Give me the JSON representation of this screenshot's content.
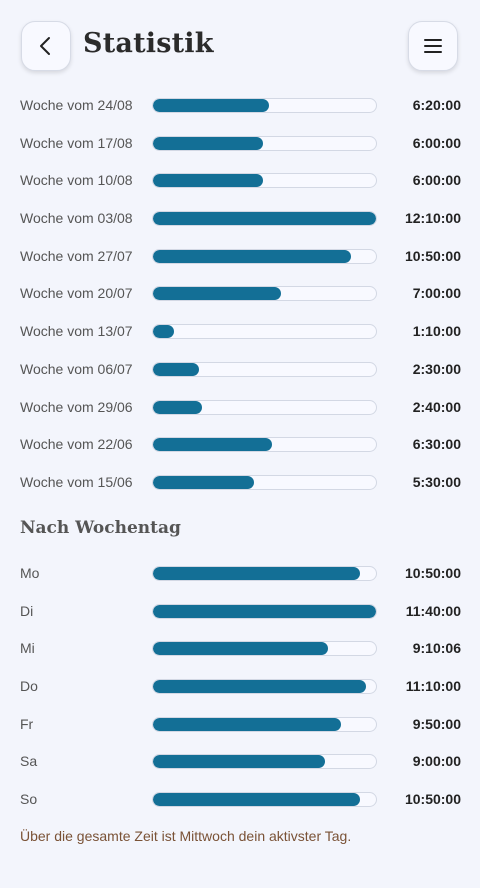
{
  "header": {
    "title": "Statistik",
    "back_icon": "chevron-left-icon",
    "menu_icon": "hamburger-menu-icon"
  },
  "weeks": [
    {
      "label": "Woche vom 24/08",
      "time": "6:20:00",
      "fraction": 0.519
    },
    {
      "label": "Woche vom 17/08",
      "time": "6:00:00",
      "fraction": 0.492
    },
    {
      "label": "Woche vom 10/08",
      "time": "6:00:00",
      "fraction": 0.492
    },
    {
      "label": "Woche vom 03/08",
      "time": "12:10:00",
      "fraction": 1.0
    },
    {
      "label": "Woche vom 27/07",
      "time": "10:50:00",
      "fraction": 0.89
    },
    {
      "label": "Woche vom 20/07",
      "time": "7:00:00",
      "fraction": 0.575
    },
    {
      "label": "Woche vom 13/07",
      "time": "1:10:00",
      "fraction": 0.096
    },
    {
      "label": "Woche vom 06/07",
      "time": "2:30:00",
      "fraction": 0.205
    },
    {
      "label": "Woche vom 29/06",
      "time": "2:40:00",
      "fraction": 0.219
    },
    {
      "label": "Woche vom 22/06",
      "time": "6:30:00",
      "fraction": 0.534
    },
    {
      "label": "Woche vom 15/06",
      "time": "5:30:00",
      "fraction": 0.452
    }
  ],
  "weekday_section": {
    "title": "Nach Wochentag",
    "days": [
      {
        "label": "Mo",
        "time": "10:50:00",
        "fraction": 0.929
      },
      {
        "label": "Di",
        "time": "11:40:00",
        "fraction": 1.0
      },
      {
        "label": "Mi",
        "time": "9:10:06",
        "fraction": 0.786
      },
      {
        "label": "Do",
        "time": "11:10:00",
        "fraction": 0.957
      },
      {
        "label": "Fr",
        "time": "9:50:00",
        "fraction": 0.843
      },
      {
        "label": "Sa",
        "time": "9:00:00",
        "fraction": 0.771
      },
      {
        "label": "So",
        "time": "10:50:00",
        "fraction": 0.929
      }
    ]
  },
  "footnote": "Über die gesamte Zeit ist Mittwoch dein aktivster Tag.",
  "colors": {
    "background": "#f3f5fc",
    "bar_fill": "#136f96",
    "bar_track": "#f8f9ff",
    "footnote": "#7a5236"
  }
}
